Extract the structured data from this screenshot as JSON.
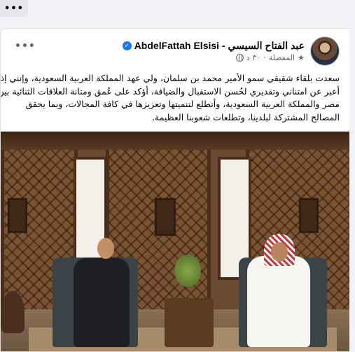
{
  "top_more_label": "•••",
  "post": {
    "more_label": "•••",
    "author": "AbdelFattah Elsisi - عبد الفتاح السيسي",
    "verified": true,
    "timestamp": "٣٠ د",
    "privacy": "المفضلة",
    "text_lines": [
      "سعدت بلقاء شقيقي سمو الأمير محمد بن سلمان، ولي عهد المملكة العربية السعودية، وإنني إذ",
      "أعبر عن امتناني وتقديري لحُسن الاستقبال والضيافة، أؤكد على عُمق ومتانة العلاقات الثنائية بين",
      "مصر والمملكة العربية السعودية، وأتطلع لتنميتها وتعزيزها في كافة المجالات، وبما يحقق",
      "المصالح المشتركة لبلدينا، وتطلعات شعوبنا العظيمة."
    ]
  },
  "colors": {
    "verified_blue": "#1877f2",
    "text": "#050505",
    "muted": "#65676b"
  },
  "icons": [
    "verified-badge-icon",
    "globe-icon",
    "star-icon",
    "more-options-icon"
  ]
}
